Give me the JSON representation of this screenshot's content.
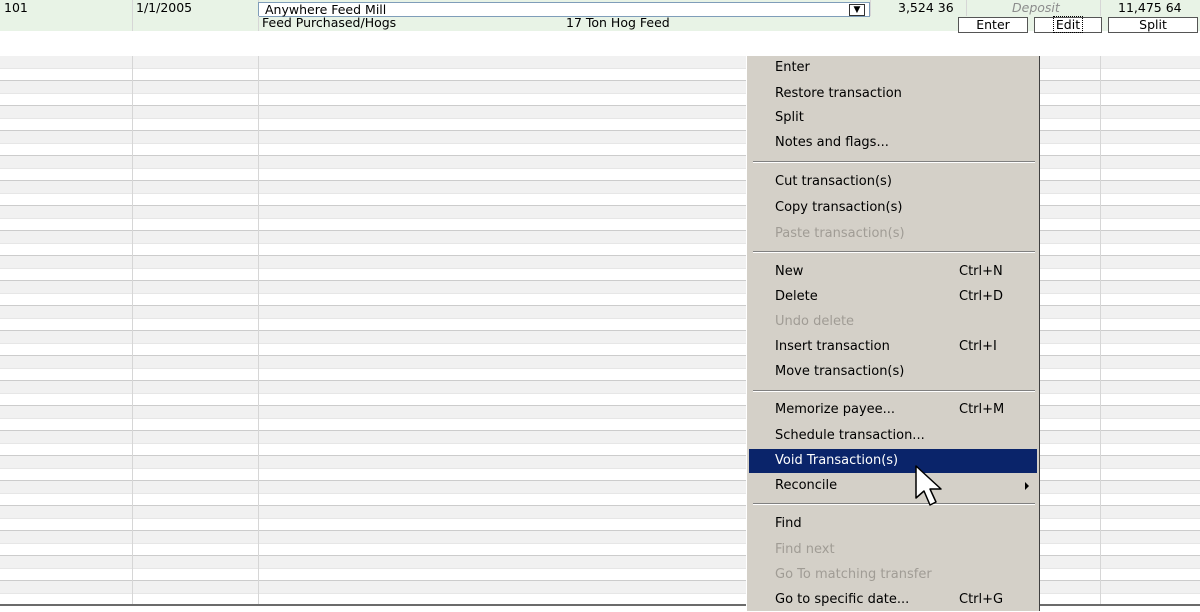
{
  "transaction": {
    "num": "101",
    "date": "1/1/2005",
    "payee": "Anywhere Feed Mill",
    "payment": "3,524 36",
    "deposit_placeholder": "Deposit",
    "balance": "11,475 64",
    "category": "Feed Purchased/Hogs",
    "memo": "17 Ton Hog Feed"
  },
  "buttons": {
    "enter": "Enter",
    "edit": "Edit",
    "split": "Split"
  },
  "context_menu": {
    "items": [
      {
        "label": "Enter",
        "shortcut": ""
      },
      {
        "label": "Restore transaction",
        "shortcut": ""
      },
      {
        "label": "Split",
        "shortcut": ""
      },
      {
        "label": "Notes and flags...",
        "shortcut": ""
      },
      {
        "label": "Cut transaction(s)",
        "shortcut": ""
      },
      {
        "label": "Copy transaction(s)",
        "shortcut": ""
      },
      {
        "label": "Paste transaction(s)",
        "shortcut": ""
      },
      {
        "label": "New",
        "shortcut": "Ctrl+N"
      },
      {
        "label": "Delete",
        "shortcut": "Ctrl+D"
      },
      {
        "label": "Undo delete",
        "shortcut": ""
      },
      {
        "label": "Insert transaction",
        "shortcut": "Ctrl+I"
      },
      {
        "label": "Move transaction(s)",
        "shortcut": ""
      },
      {
        "label": "Memorize payee...",
        "shortcut": "Ctrl+M"
      },
      {
        "label": "Schedule transaction...",
        "shortcut": ""
      },
      {
        "label": "Void Transaction(s)",
        "shortcut": ""
      },
      {
        "label": "Reconcile",
        "shortcut": ""
      },
      {
        "label": "Find",
        "shortcut": ""
      },
      {
        "label": "Find next",
        "shortcut": ""
      },
      {
        "label": "Go To matching transfer",
        "shortcut": ""
      },
      {
        "label": "Go to specific date...",
        "shortcut": "Ctrl+G"
      }
    ]
  },
  "colors": {
    "active_row": "#e8f3e6",
    "menu_bg": "#d4d0c8",
    "menu_highlight": "#0a246a",
    "disabled_text": "#a09c95"
  }
}
